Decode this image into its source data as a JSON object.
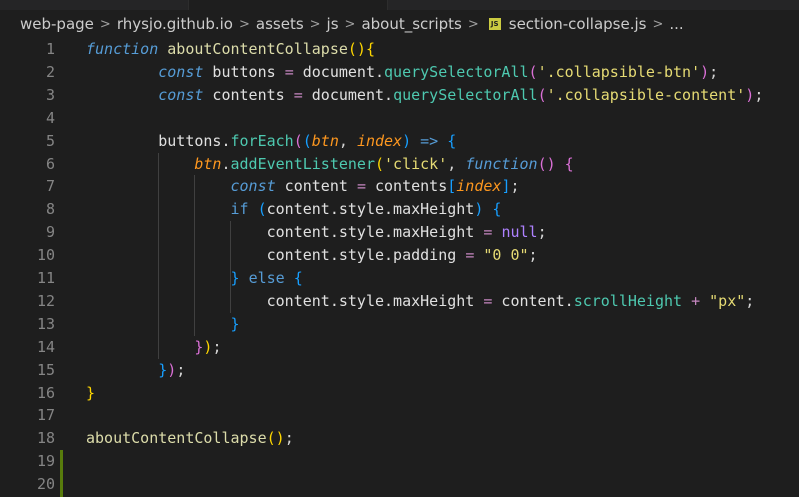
{
  "breadcrumb": {
    "items": [
      "web-page",
      "rhysjo.github.io",
      "assets",
      "js",
      "about_scripts"
    ],
    "separator": ">",
    "file_icon": "js-file-icon",
    "file_icon_text": "JS",
    "file": "section-collapse.js",
    "trailing_sep": ">",
    "ellipsis": "..."
  },
  "editor": {
    "line_numbers": [
      "1",
      "2",
      "3",
      "4",
      "5",
      "6",
      "7",
      "8",
      "9",
      "10",
      "11",
      "12",
      "13",
      "14",
      "15",
      "16",
      "17",
      "18",
      "19",
      "20"
    ],
    "lines": [
      [
        {
          "t": "function",
          "c": "kw"
        },
        {
          "t": " ",
          "c": "plain"
        },
        {
          "t": "aboutContentCollapse",
          "c": "fn"
        },
        {
          "t": "()",
          "c": "br1"
        },
        {
          "t": "{",
          "c": "br1"
        }
      ],
      [
        {
          "t": "        ",
          "c": "plain"
        },
        {
          "t": "const",
          "c": "kw"
        },
        {
          "t": " buttons ",
          "c": "ident"
        },
        {
          "t": "=",
          "c": "op"
        },
        {
          "t": " document.",
          "c": "ident"
        },
        {
          "t": "querySelectorAll",
          "c": "meth"
        },
        {
          "t": "(",
          "c": "br2"
        },
        {
          "t": "'.collapsible-btn'",
          "c": "str"
        },
        {
          "t": ")",
          "c": "br2"
        },
        {
          "t": ";",
          "c": "plain"
        }
      ],
      [
        {
          "t": "        ",
          "c": "plain"
        },
        {
          "t": "const",
          "c": "kw"
        },
        {
          "t": " contents ",
          "c": "ident"
        },
        {
          "t": "=",
          "c": "op"
        },
        {
          "t": " document.",
          "c": "ident"
        },
        {
          "t": "querySelectorAll",
          "c": "meth"
        },
        {
          "t": "(",
          "c": "br2"
        },
        {
          "t": "'.collapsible-content'",
          "c": "str"
        },
        {
          "t": ")",
          "c": "br2"
        },
        {
          "t": ";",
          "c": "plain"
        }
      ],
      [],
      [
        {
          "t": "        ",
          "c": "plain"
        },
        {
          "t": "buttons.",
          "c": "ident"
        },
        {
          "t": "forEach",
          "c": "meth"
        },
        {
          "t": "(",
          "c": "br2"
        },
        {
          "t": "(",
          "c": "br3"
        },
        {
          "t": "btn",
          "c": "param"
        },
        {
          "t": ", ",
          "c": "plain"
        },
        {
          "t": "index",
          "c": "param"
        },
        {
          "t": ")",
          "c": "br3"
        },
        {
          "t": " ",
          "c": "plain"
        },
        {
          "t": "=>",
          "c": "kwn"
        },
        {
          "t": " ",
          "c": "plain"
        },
        {
          "t": "{",
          "c": "br3"
        }
      ],
      [
        {
          "t": "            ",
          "c": "plain"
        },
        {
          "t": "btn",
          "c": "param"
        },
        {
          "t": ".",
          "c": "plain"
        },
        {
          "t": "addEventListener",
          "c": "meth"
        },
        {
          "t": "(",
          "c": "br1"
        },
        {
          "t": "'click'",
          "c": "str"
        },
        {
          "t": ", ",
          "c": "plain"
        },
        {
          "t": "function",
          "c": "kw"
        },
        {
          "t": "()",
          "c": "br2"
        },
        {
          "t": " ",
          "c": "plain"
        },
        {
          "t": "{",
          "c": "br2"
        }
      ],
      [
        {
          "t": "                ",
          "c": "plain"
        },
        {
          "t": "const",
          "c": "kw"
        },
        {
          "t": " content ",
          "c": "ident"
        },
        {
          "t": "=",
          "c": "op"
        },
        {
          "t": " contents",
          "c": "ident"
        },
        {
          "t": "[",
          "c": "br3"
        },
        {
          "t": "index",
          "c": "param"
        },
        {
          "t": "]",
          "c": "br3"
        },
        {
          "t": ";",
          "c": "plain"
        }
      ],
      [
        {
          "t": "                ",
          "c": "plain"
        },
        {
          "t": "if",
          "c": "ctrl"
        },
        {
          "t": " ",
          "c": "plain"
        },
        {
          "t": "(",
          "c": "br3"
        },
        {
          "t": "content.style.maxHeight",
          "c": "ident"
        },
        {
          "t": ")",
          "c": "br3"
        },
        {
          "t": " ",
          "c": "plain"
        },
        {
          "t": "{",
          "c": "br3"
        }
      ],
      [
        {
          "t": "                    ",
          "c": "plain"
        },
        {
          "t": "content.style.maxHeight ",
          "c": "ident"
        },
        {
          "t": "=",
          "c": "op"
        },
        {
          "t": " ",
          "c": "plain"
        },
        {
          "t": "null",
          "c": "nul"
        },
        {
          "t": ";",
          "c": "plain"
        }
      ],
      [
        {
          "t": "                    ",
          "c": "plain"
        },
        {
          "t": "content.style.padding ",
          "c": "ident"
        },
        {
          "t": "=",
          "c": "op"
        },
        {
          "t": " ",
          "c": "plain"
        },
        {
          "t": "\"0 0\"",
          "c": "str"
        },
        {
          "t": ";",
          "c": "plain"
        }
      ],
      [
        {
          "t": "                ",
          "c": "plain"
        },
        {
          "t": "}",
          "c": "br3"
        },
        {
          "t": " ",
          "c": "plain"
        },
        {
          "t": "else",
          "c": "ctrl"
        },
        {
          "t": " ",
          "c": "plain"
        },
        {
          "t": "{",
          "c": "br3"
        }
      ],
      [
        {
          "t": "                    ",
          "c": "plain"
        },
        {
          "t": "content.style.maxHeight ",
          "c": "ident"
        },
        {
          "t": "=",
          "c": "op"
        },
        {
          "t": " content.",
          "c": "ident"
        },
        {
          "t": "scrollHeight",
          "c": "meth"
        },
        {
          "t": " ",
          "c": "plain"
        },
        {
          "t": "+",
          "c": "op"
        },
        {
          "t": " ",
          "c": "plain"
        },
        {
          "t": "\"px\"",
          "c": "str"
        },
        {
          "t": ";",
          "c": "plain"
        }
      ],
      [
        {
          "t": "                ",
          "c": "plain"
        },
        {
          "t": "}",
          "c": "br3"
        }
      ],
      [
        {
          "t": "            ",
          "c": "plain"
        },
        {
          "t": "}",
          "c": "br2"
        },
        {
          "t": ")",
          "c": "br1"
        },
        {
          "t": ";",
          "c": "plain"
        }
      ],
      [
        {
          "t": "        ",
          "c": "plain"
        },
        {
          "t": "}",
          "c": "br3"
        },
        {
          "t": ")",
          "c": "br2"
        },
        {
          "t": ";",
          "c": "plain"
        }
      ],
      [
        {
          "t": "}",
          "c": "br1"
        }
      ],
      [],
      [
        {
          "t": "aboutContentCollapse",
          "c": "fn"
        },
        {
          "t": "()",
          "c": "br1"
        },
        {
          "t": ";",
          "c": "plain"
        }
      ],
      [],
      []
    ]
  },
  "colors": {
    "background": "#1e1e1e",
    "line_number": "#858585",
    "git_added": "#587c0c",
    "indent_guide": "#404040"
  }
}
